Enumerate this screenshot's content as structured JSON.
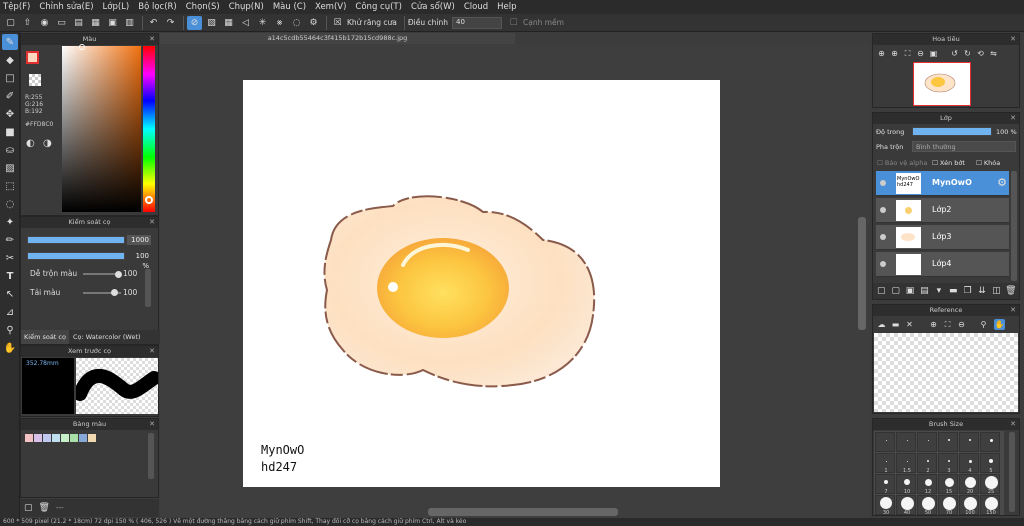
{
  "menu": [
    "Tệp(F)",
    "Chỉnh sửa(E)",
    "Lớp(L)",
    "Bộ lọc(R)",
    "Chọn(S)",
    "Chụp(N)",
    "Màu (C)",
    "Xem(V)",
    "Công cụ(T)",
    "Cửa sổ(W)",
    "Cloud",
    "Help"
  ],
  "toolbar": {
    "antialias_label": "Khử răng cưa",
    "adjust_label": "Điều chỉnh",
    "adjust_value": "40",
    "edge_label": "Cạnh mềm"
  },
  "color_panel": {
    "title": "Màu",
    "r": "R:255",
    "g": "G:216",
    "b": "B:192",
    "hex": "#FFD8C0",
    "fg_color": "#FFD8C0"
  },
  "brush_control": {
    "title": "Kiểm soát cọ",
    "size_value": "1000",
    "opacity_value": "100 %",
    "mix_label": "Dễ trộn màu",
    "mix_value": "100",
    "reload_label": "Tải màu",
    "reload_value": "100",
    "tab_label": "Kiểm soát cọ",
    "brush_name": "Cọ: Watercolor (Wet)"
  },
  "preview": {
    "title": "Xem trước cọ",
    "size": "352.78mm"
  },
  "swatches": {
    "title": "Bảng màu",
    "colors": [
      "#f4c2c2",
      "#d8c0e8",
      "#c0c8f0",
      "#c0e0f0",
      "#c8f0c8",
      "#a8e0a8",
      "#88a8d8",
      "#f0d8b0"
    ],
    "empty_label": "---"
  },
  "document": {
    "filename": "a14c5cdb55464c3f415b172b15cd988c.jpg",
    "signature_line1": "MynOwO",
    "signature_line2": "hd247"
  },
  "navigator": {
    "title": "Hoa tiêu"
  },
  "layers": {
    "title": "Lớp",
    "opacity_label": "Độ trong",
    "opacity_value": "100 %",
    "blend_label": "Pha trộn",
    "blend_value": "Bình thường",
    "protect_alpha": "Bảo vệ alpha",
    "clipping": "Xén bớt",
    "lock": "Khóa",
    "items": [
      {
        "name": "MynOwO",
        "thumb_text": "MynOwO hd247",
        "selected": true
      },
      {
        "name": "Lớp2",
        "selected": false
      },
      {
        "name": "Lớp3",
        "selected": false
      },
      {
        "name": "Lớp4",
        "selected": false
      }
    ]
  },
  "reference": {
    "title": "Reference"
  },
  "brush_size": {
    "title": "Brush Size",
    "row1": [
      "1",
      "1.5",
      "2",
      "3",
      "4",
      "5"
    ],
    "row2": [
      "7",
      "10",
      "12",
      "15",
      "20",
      "25"
    ],
    "row3": [
      "30",
      "40",
      "50",
      "70",
      "100",
      "150"
    ]
  },
  "status": {
    "text": "600 * 509 pixel  (21.2 * 18cm)  72 dpi  150 %  ( 406, 526 )  Vẽ một đường thẳng bằng cách giữ phím Shift, Thay đổi cỡ cọ bằng cách giữ phím Ctrl, Alt và kéo"
  }
}
